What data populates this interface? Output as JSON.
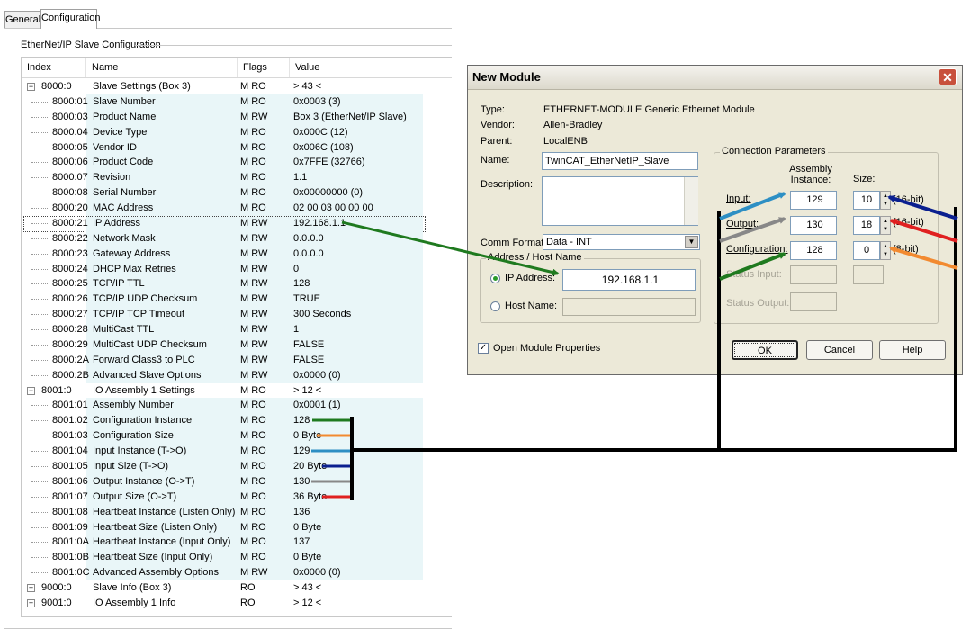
{
  "tabs": {
    "general": "General",
    "configuration": "Configuration"
  },
  "group_title": "EtherNet/IP Slave Configuration",
  "columns": {
    "index": "Index",
    "name": "Name",
    "flags": "Flags",
    "value": "Value"
  },
  "rows": [
    {
      "index": "8000:0",
      "name": "Slave Settings (Box 3)",
      "flags": "M RO",
      "value": "> 43 <",
      "top": true,
      "expander": "−"
    },
    {
      "index": "8000:01",
      "name": "Slave Number",
      "flags": "M RO",
      "value": "0x0003 (3)"
    },
    {
      "index": "8000:03",
      "name": "Product Name",
      "flags": "M RW",
      "value": "Box 3 (EtherNet/IP Slave)"
    },
    {
      "index": "8000:04",
      "name": "Device Type",
      "flags": "M RO",
      "value": "0x000C (12)"
    },
    {
      "index": "8000:05",
      "name": "Vendor ID",
      "flags": "M RO",
      "value": "0x006C (108)"
    },
    {
      "index": "8000:06",
      "name": "Product Code",
      "flags": "M RO",
      "value": "0x7FFE (32766)"
    },
    {
      "index": "8000:07",
      "name": "Revision",
      "flags": "M RO",
      "value": "1.1"
    },
    {
      "index": "8000:08",
      "name": "Serial Number",
      "flags": "M RO",
      "value": "0x00000000 (0)"
    },
    {
      "index": "8000:20",
      "name": "MAC Address",
      "flags": "M RO",
      "value": "02 00 03 00 00 00"
    },
    {
      "index": "8000:21",
      "name": "IP Address",
      "flags": "M RW",
      "value": "192.168.1.1",
      "selected": true
    },
    {
      "index": "8000:22",
      "name": "Network Mask",
      "flags": "M RW",
      "value": "0.0.0.0"
    },
    {
      "index": "8000:23",
      "name": "Gateway Address",
      "flags": "M RW",
      "value": "0.0.0.0"
    },
    {
      "index": "8000:24",
      "name": "DHCP Max Retries",
      "flags": "M RW",
      "value": "0"
    },
    {
      "index": "8000:25",
      "name": "TCP/IP TTL",
      "flags": "M RW",
      "value": "128"
    },
    {
      "index": "8000:26",
      "name": "TCP/IP UDP Checksum",
      "flags": "M RW",
      "value": "TRUE"
    },
    {
      "index": "8000:27",
      "name": "TCP/IP TCP Timeout",
      "flags": "M RW",
      "value": "300 Seconds"
    },
    {
      "index": "8000:28",
      "name": "MultiCast TTL",
      "flags": "M RW",
      "value": "1"
    },
    {
      "index": "8000:29",
      "name": "MultiCast UDP Checksum",
      "flags": "M RW",
      "value": "FALSE"
    },
    {
      "index": "8000:2A",
      "name": "Forward Class3 to PLC",
      "flags": "M RW",
      "value": "FALSE"
    },
    {
      "index": "8000:2B",
      "name": "Advanced Slave Options",
      "flags": "M RW",
      "value": "0x0000 (0)"
    },
    {
      "index": "8001:0",
      "name": "IO Assembly 1 Settings",
      "flags": "M RO",
      "value": "> 12 <",
      "top": true,
      "expander": "−"
    },
    {
      "index": "8001:01",
      "name": "Assembly Number",
      "flags": "M RO",
      "value": "0x0001 (1)"
    },
    {
      "index": "8001:02",
      "name": "Configuration Instance",
      "flags": "M RO",
      "value": "128"
    },
    {
      "index": "8001:03",
      "name": "Configuration Size",
      "flags": "M RO",
      "value": "0 Byte"
    },
    {
      "index": "8001:04",
      "name": "Input Instance (T->O)",
      "flags": "M RO",
      "value": "129"
    },
    {
      "index": "8001:05",
      "name": "Input Size (T->O)",
      "flags": "M RO",
      "value": "20 Byte"
    },
    {
      "index": "8001:06",
      "name": "Output Instance (O->T)",
      "flags": "M RO",
      "value": "130"
    },
    {
      "index": "8001:07",
      "name": "Output Size (O->T)",
      "flags": "M RO",
      "value": "36 Byte"
    },
    {
      "index": "8001:08",
      "name": "Heartbeat Instance (Listen Only)",
      "flags": "M RO",
      "value": "136"
    },
    {
      "index": "8001:09",
      "name": "Heartbeat Size (Listen Only)",
      "flags": "M RO",
      "value": "0 Byte"
    },
    {
      "index": "8001:0A",
      "name": "Heartbeat Instance (Input Only)",
      "flags": "M RO",
      "value": "137"
    },
    {
      "index": "8001:0B",
      "name": "Heartbeat Size (Input Only)",
      "flags": "M RO",
      "value": "0 Byte"
    },
    {
      "index": "8001:0C",
      "name": "Advanced Assembly Options",
      "flags": "M RW",
      "value": "0x0000 (0)"
    },
    {
      "index": "9000:0",
      "name": "Slave Info (Box 3)",
      "flags": "RO",
      "value": "> 43 <",
      "top": true,
      "expander": "+"
    },
    {
      "index": "9001:0",
      "name": "IO Assembly 1 Info",
      "flags": "RO",
      "value": "> 12 <",
      "top": true,
      "expander": "+"
    }
  ],
  "dialog": {
    "title": "New Module",
    "close_glyph": "✕",
    "type_label": "Type:",
    "type_value": "ETHERNET-MODULE Generic Ethernet Module",
    "vendor_label": "Vendor:",
    "vendor_value": "Allen-Bradley",
    "parent_label": "Parent:",
    "parent_value": "LocalENB",
    "name_label": "Name:",
    "name_value": "TwinCAT_EtherNetIP_Slave",
    "description_label": "Description:",
    "description_value": "",
    "comm_format_label": "Comm Format:",
    "comm_format_value": "Data - INT",
    "address_group": "Address / Host Name",
    "ip_label": "IP Address:",
    "ip_value": "192.168.1.1",
    "host_label": "Host Name:",
    "host_value": "",
    "open_props_label": "Open Module Properties",
    "conn_group": "Connection Parameters",
    "assembly_header": "Assembly Instance:",
    "size_header": "Size:",
    "input_label": "Input:",
    "input_instance": "129",
    "input_size": "10",
    "input_unit": "(16-bit)",
    "output_label": "Output:",
    "output_instance": "130",
    "output_size": "18",
    "output_unit": "(16-bit)",
    "config_label": "Configuration:",
    "config_instance": "128",
    "config_size": "0",
    "config_unit": "(8-bit)",
    "status_input_label": "Status Input:",
    "status_output_label": "Status Output:",
    "ok_label": "OK",
    "cancel_label": "Cancel",
    "help_label": "Help"
  },
  "colors": {
    "row_shade": "#e9f6f8",
    "arrow_ip": "#1f7a1f",
    "arrow_config_instance": "#1f7a1f",
    "arrow_config_size": "#f28a30",
    "arrow_input_instance": "#2d8fc4",
    "arrow_input_size": "#0a1f8f",
    "arrow_output_instance": "#888888",
    "arrow_output_size": "#e02020",
    "bracket": "#000000"
  }
}
